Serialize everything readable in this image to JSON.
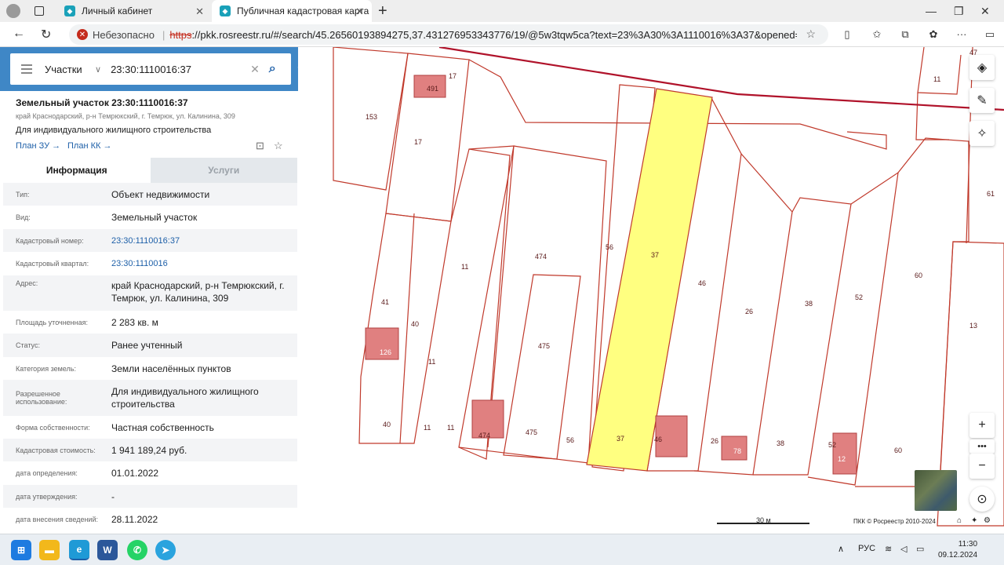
{
  "browser": {
    "tabs": [
      {
        "title": "Личный кабинет"
      },
      {
        "title": "Публичная кадастровая карта"
      }
    ],
    "security_label": "Небезопасно",
    "url_scheme": "https",
    "url_rest": "://pkk.rosreestr.ru/#/search/45.26560193894275,37.431276953343776/19/@5w3tqw5ca?text=23%3A30%3A1110016%3A37&opened=23%3A30%3A..."
  },
  "search": {
    "type_label": "Участки",
    "query": "23:30:1110016:37"
  },
  "object": {
    "title": "Земельный участок 23:30:1110016:37",
    "address_short": "край Краснодарский, р-н Темрюкский, г. Темрюк, ул. Калинина, 309",
    "use": "Для индивидуального жилищного строительства",
    "plan_zu": "План ЗУ",
    "plan_kk": "План КК"
  },
  "info_tabs": {
    "info": "Информация",
    "services": "Услуги"
  },
  "rows": [
    {
      "label": "Тип:",
      "value": "Объект недвижимости"
    },
    {
      "label": "Вид:",
      "value": "Земельный участок"
    },
    {
      "label": "Кадастровый номер:",
      "value": "23:30:1110016:37",
      "link": true
    },
    {
      "label": "Кадастровый квартал:",
      "value": "23:30:1110016",
      "link": true
    },
    {
      "label": "Адрес:",
      "value": "край Краснодарский, р-н Темрюкский, г. Темрюк, ул. Калинина, 309"
    },
    {
      "label": "Площадь уточненная:",
      "value": "2 283 кв. м"
    },
    {
      "label": "Статус:",
      "value": "Ранее учтенный"
    },
    {
      "label": "Категория земель:",
      "value": "Земли населённых пунктов"
    },
    {
      "label": "Разрешенное использование:",
      "value": "Для индивидуального жилищного строительства"
    },
    {
      "label": "Форма собственности:",
      "value": "Частная собственность"
    },
    {
      "label": "Кадастровая стоимость:",
      "value": "1 941 189,24 руб."
    },
    {
      "label": "дата определения:",
      "value": "01.01.2022"
    },
    {
      "label": "дата утверждения:",
      "value": "-"
    },
    {
      "label": "дата внесения сведений:",
      "value": "28.11.2022"
    }
  ],
  "map": {
    "labels": [
      "47",
      "17",
      "491",
      "153",
      "17",
      "11",
      "61",
      "474",
      "56",
      "37",
      "46",
      "26",
      "38",
      "52",
      "60",
      "13",
      "41",
      "40",
      "11",
      "126",
      "475",
      "11",
      "40",
      "11",
      "11",
      "474",
      "475",
      "56",
      "37",
      "46",
      "26",
      "78",
      "38",
      "52",
      "60",
      "12"
    ],
    "scale": "30 м",
    "copyright": "ПКК © Росреестр 2010-2024",
    "selected_fill": "#ffff80",
    "boundary_color": "#c0392b"
  },
  "taskbar": {
    "lang": "РУС",
    "time": "11:30",
    "date": "09.12.2024"
  }
}
